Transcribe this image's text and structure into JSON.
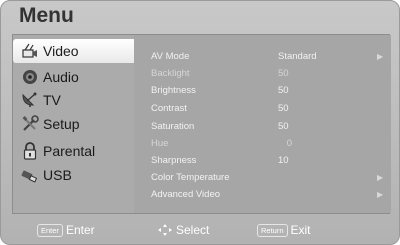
{
  "menu": {
    "title": "Menu"
  },
  "sidebar": {
    "items": [
      {
        "label": "Video",
        "icon": "video-camera-icon",
        "selected": true
      },
      {
        "label": "Audio",
        "icon": "speaker-icon",
        "selected": false
      },
      {
        "label": "TV",
        "icon": "satellite-dish-icon",
        "selected": false
      },
      {
        "label": "Setup",
        "icon": "tools-icon",
        "selected": false
      },
      {
        "label": "Parental",
        "icon": "padlock-icon",
        "selected": false
      },
      {
        "label": "USB",
        "icon": "usb-plug-icon",
        "selected": false
      }
    ]
  },
  "video_settings": {
    "rows": [
      {
        "label": "AV Mode",
        "value": "Standard",
        "arrow": "▶"
      },
      {
        "label": "Backlight",
        "value": "50",
        "arrow": ""
      },
      {
        "label": "Brightness",
        "value": "50",
        "arrow": ""
      },
      {
        "label": "Contrast",
        "value": "50",
        "arrow": ""
      },
      {
        "label": "Saturation",
        "value": "50",
        "arrow": ""
      },
      {
        "label": "Hue",
        "value": "0",
        "arrow": ""
      },
      {
        "label": "Sharpness",
        "value": "10",
        "arrow": ""
      },
      {
        "label": "Color Temperature",
        "value": "",
        "arrow": "▶"
      },
      {
        "label": "Advanced Video",
        "value": "",
        "arrow": "▶"
      }
    ]
  },
  "footer": {
    "enter_key": "Enter",
    "enter_label": "Enter",
    "select_label": "Select",
    "return_key": "Return",
    "exit_label": "Exit"
  }
}
